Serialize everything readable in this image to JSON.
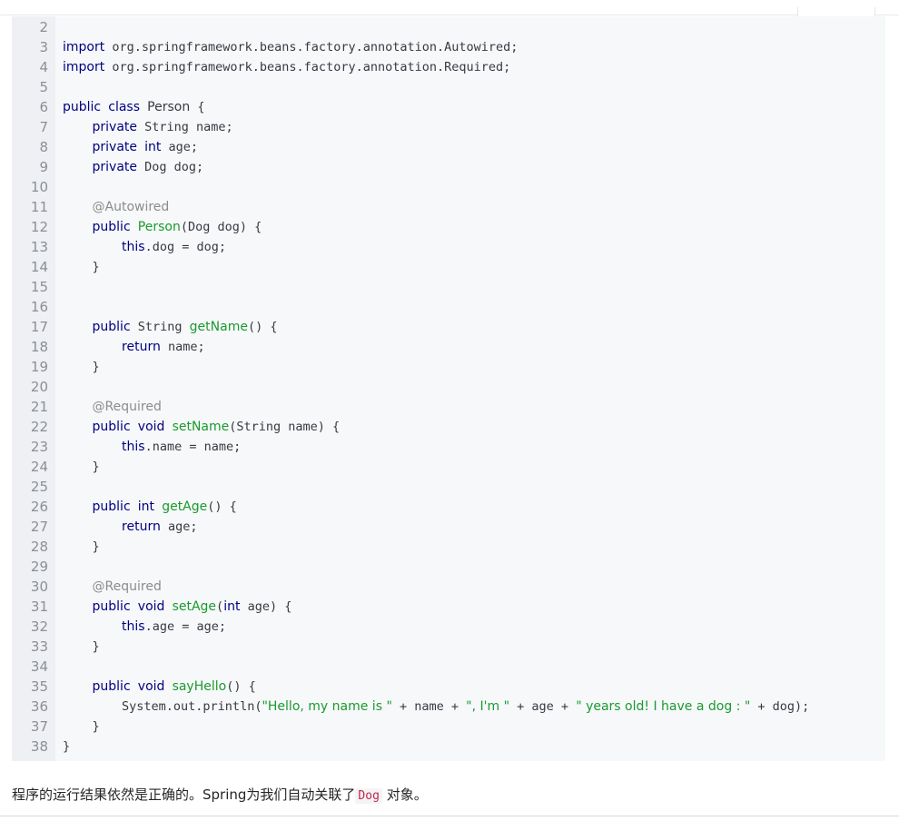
{
  "code_block": {
    "lines": [
      {
        "num": "2",
        "text": ""
      },
      {
        "num": "3",
        "text": "import org.springframework.beans.factory.annotation.Autowired;"
      },
      {
        "num": "4",
        "text": "import org.springframework.beans.factory.annotation.Required;"
      },
      {
        "num": "5",
        "text": ""
      },
      {
        "num": "6",
        "text": "public class Person {"
      },
      {
        "num": "7",
        "text": "    private String name;"
      },
      {
        "num": "8",
        "text": "    private int age;"
      },
      {
        "num": "9",
        "text": "    private Dog dog;"
      },
      {
        "num": "10",
        "text": ""
      },
      {
        "num": "11",
        "text": "    @Autowired"
      },
      {
        "num": "12",
        "text": "    public Person(Dog dog) {"
      },
      {
        "num": "13",
        "text": "        this.dog = dog;"
      },
      {
        "num": "14",
        "text": "    }"
      },
      {
        "num": "15",
        "text": ""
      },
      {
        "num": "16",
        "text": ""
      },
      {
        "num": "17",
        "text": "    public String getName() {"
      },
      {
        "num": "18",
        "text": "        return name;"
      },
      {
        "num": "19",
        "text": "    }"
      },
      {
        "num": "20",
        "text": ""
      },
      {
        "num": "21",
        "text": "    @Required"
      },
      {
        "num": "22",
        "text": "    public void setName(String name) {"
      },
      {
        "num": "23",
        "text": "        this.name = name;"
      },
      {
        "num": "24",
        "text": "    }"
      },
      {
        "num": "25",
        "text": ""
      },
      {
        "num": "26",
        "text": "    public int getAge() {"
      },
      {
        "num": "27",
        "text": "        return age;"
      },
      {
        "num": "28",
        "text": "    }"
      },
      {
        "num": "29",
        "text": ""
      },
      {
        "num": "30",
        "text": "    @Required"
      },
      {
        "num": "31",
        "text": "    public void setAge(int age) {"
      },
      {
        "num": "32",
        "text": "        this.age = age;"
      },
      {
        "num": "33",
        "text": "    }"
      },
      {
        "num": "34",
        "text": ""
      },
      {
        "num": "35",
        "text": "    public void sayHello() {"
      },
      {
        "num": "36",
        "text": "        System.out.println(\"Hello, my name is \" + name + \", I'm \" + age + \" years old! I have a dog : \" + dog);"
      },
      {
        "num": "37",
        "text": "    }"
      },
      {
        "num": "38",
        "text": "}"
      }
    ]
  },
  "prose": {
    "before": "程序的运行结果依然是正确的。Spring为我们自动关联了",
    "code": "Dog",
    "after": "对象。"
  },
  "colors": {
    "keyword": "#000080",
    "function": "#1b9a2e",
    "string": "#1b9a2e",
    "annotation": "#8c8c8c",
    "inline_code": "#c7254e"
  }
}
